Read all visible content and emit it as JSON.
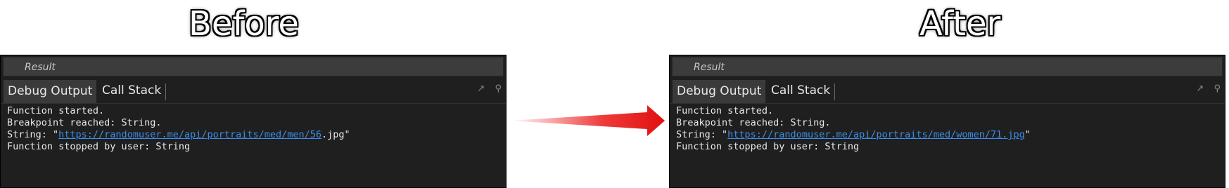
{
  "headings": {
    "before": "Before",
    "after": "After"
  },
  "before": {
    "result_label": "Result",
    "tabs": {
      "debug_output": "Debug Output",
      "call_stack": "Call Stack"
    },
    "console": {
      "line1": "Function started.",
      "line2": "Breakpoint reached: String.",
      "line3_prefix": "String: \"",
      "line3_link": "https://randomuser.me/api/portraits/med/men/56",
      "line3_suffix": ".jpg\"",
      "line4": "Function stopped by user: String"
    }
  },
  "after": {
    "result_label": "Result",
    "tabs": {
      "debug_output": "Debug Output",
      "call_stack": "Call Stack"
    },
    "console": {
      "line1": "Function started.",
      "line2": "Breakpoint reached: String.",
      "line3_prefix": "String: \"",
      "line3_link": "https://randomuser.me/api/portraits/med/women/71.jpg",
      "line3_suffix": "\"",
      "line4": "Function stopped by user: String"
    }
  },
  "icons": {
    "arrow": "arrow-right-icon",
    "popout": "popout-icon",
    "pin": "pin-icon"
  },
  "colors": {
    "panel_bg": "#1f1f1f",
    "link": "#3b8eea",
    "arrow": "#e51c1c"
  }
}
